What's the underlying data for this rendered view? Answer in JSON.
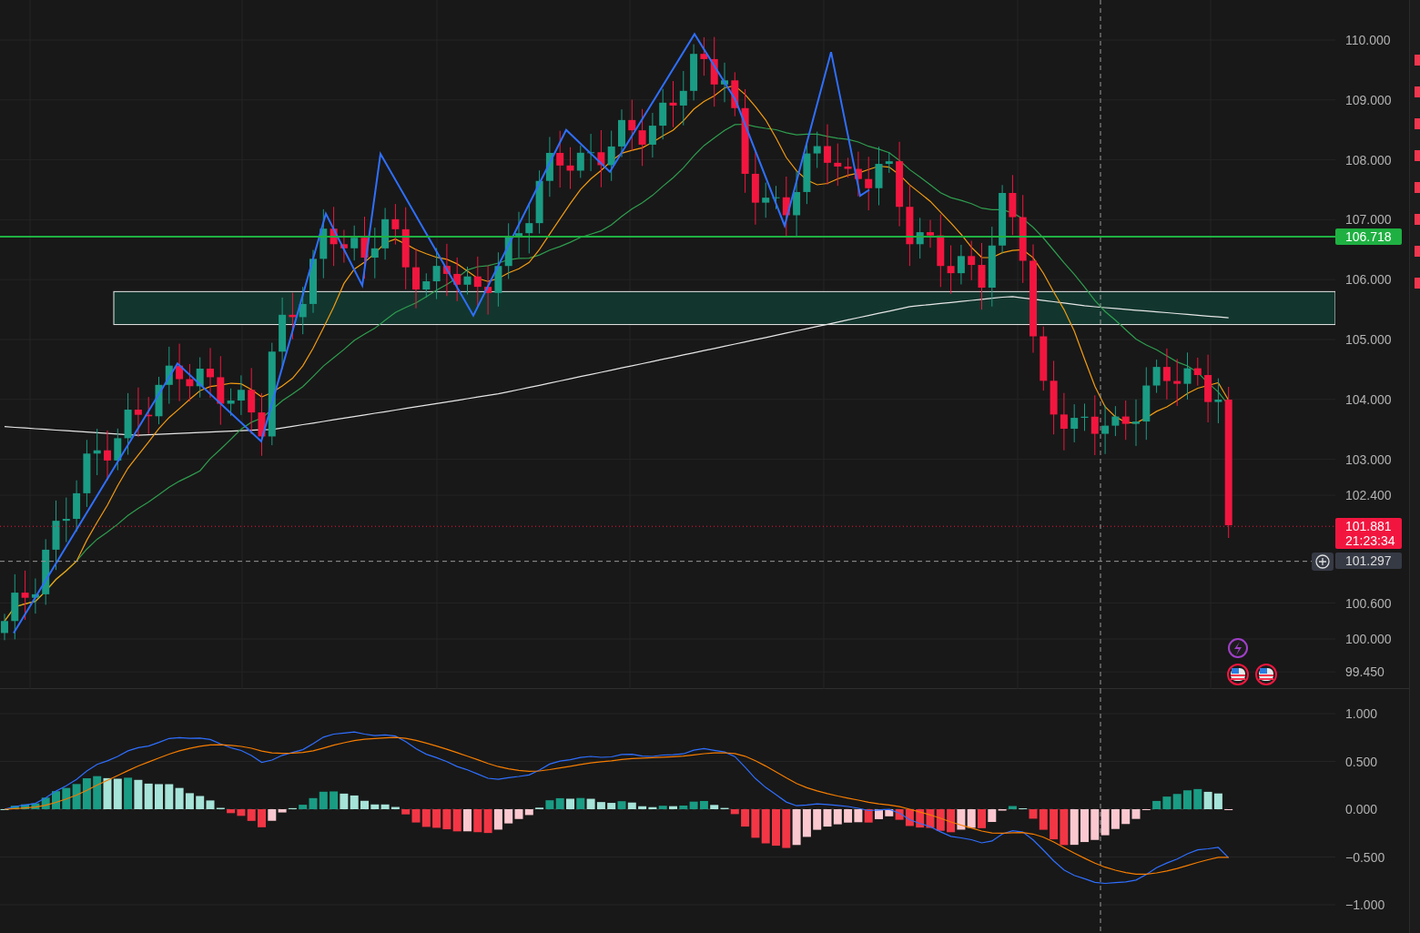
{
  "price_axis": {
    "ticks": [
      "110.000",
      "109.000",
      "108.000",
      "107.000",
      "106.000",
      "105.000",
      "104.000",
      "103.000",
      "102.400",
      "100.600",
      "100.000",
      "99.450"
    ]
  },
  "price_labels": [
    {
      "kind": "level",
      "value": "106.718",
      "color": "#1fb042"
    },
    {
      "kind": "last",
      "value": "101.881",
      "time": "21:23:34",
      "color": "#f2163f"
    },
    {
      "kind": "crosshair",
      "value": "101.297",
      "color": "#363a45"
    }
  ],
  "macd_axis": {
    "ticks": [
      "1.000",
      "0.500",
      "0.000",
      "−0.500",
      "−1.000"
    ]
  }
}
